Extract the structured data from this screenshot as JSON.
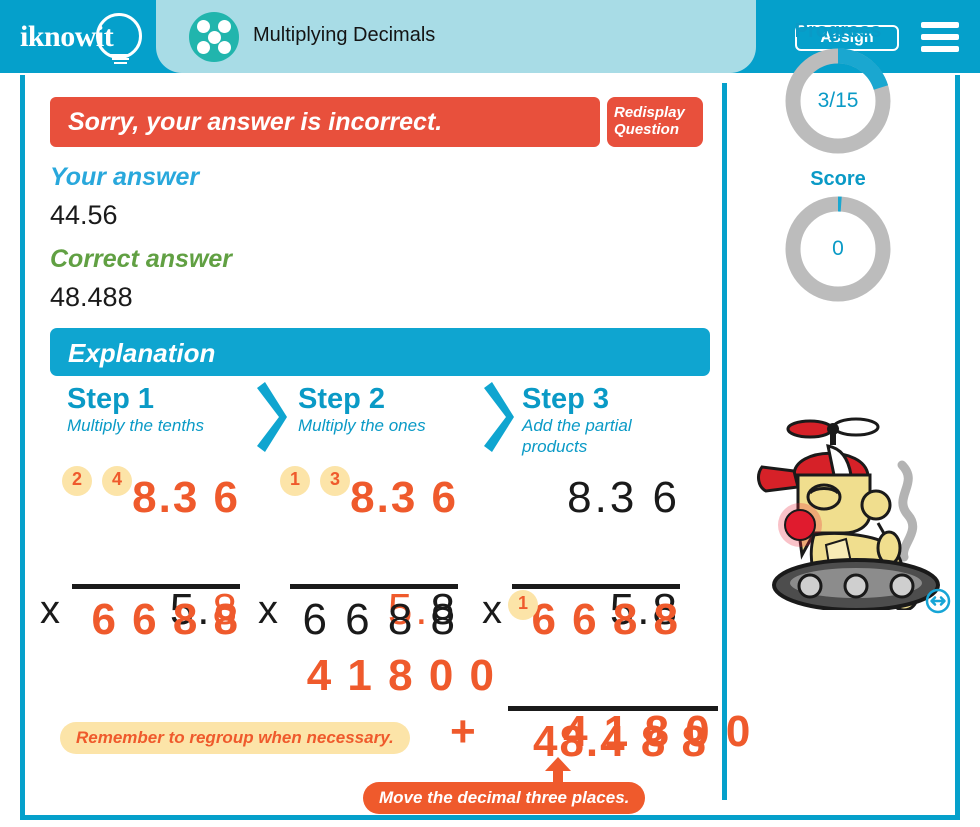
{
  "header": {
    "logo_text": "iknowit",
    "topic_title": "Multiplying Decimals",
    "assign_label": "Assign",
    "menu_icon": "hamburger-menu-icon",
    "badge_icon": "five-dots-badge-icon"
  },
  "feedback": {
    "message": "Sorry, your answer is incorrect.",
    "redisplay_line1": "Redisplay",
    "redisplay_line2": "Question",
    "your_answer_label": "Your answer",
    "your_answer_value": "44.56",
    "correct_answer_label": "Correct answer",
    "correct_answer_value": "48.488"
  },
  "explanation": {
    "title": "Explanation",
    "steps": [
      {
        "num": "Step 1",
        "sub": "Multiply the tenths"
      },
      {
        "num": "Step 2",
        "sub": "Multiply the ones"
      },
      {
        "num": "Step 3",
        "sub": "Add the partial products"
      }
    ],
    "work": {
      "step1": {
        "carries": [
          "2",
          "4"
        ],
        "multiplicand": "8.3 6",
        "operator": "x",
        "multiplier": "5.8",
        "product": "6 6 8 8"
      },
      "step2": {
        "carries": [
          "1",
          "3"
        ],
        "multiplicand": "8.3 6",
        "operator": "x",
        "multiplier": "5.8",
        "partial1": "6 6 8 8",
        "partial2": "4 1 8 0 0"
      },
      "step3": {
        "carries": [
          "1"
        ],
        "multiplicand": "8.3 6",
        "operator": "x",
        "multiplier": "5.8",
        "partial1": "6 6 8 8",
        "plus": "+",
        "partial2": "4 1 8 0 0",
        "total": "48.4 8 8"
      }
    },
    "hint_regroup": "Remember to regroup when necessary.",
    "hint_decimal": "Move the decimal three places."
  },
  "sidebar": {
    "progress_label": "Progress",
    "progress_value": "3/15",
    "progress_percent": 20,
    "score_label": "Score",
    "score_value": "0",
    "score_percent": 0,
    "mascot_icon": "robot-mascot-icon",
    "resize_icon": "resize-horizontal-icon"
  },
  "colors": {
    "brand_blue": "#05a0cb",
    "light_blue": "#a8dce6",
    "teal": "#21b5ad",
    "red": "#e8503c",
    "orange": "#ef5a2c",
    "green": "#61a043",
    "yellow": "#fce4a8",
    "gray_ring": "#bcbcbc"
  }
}
